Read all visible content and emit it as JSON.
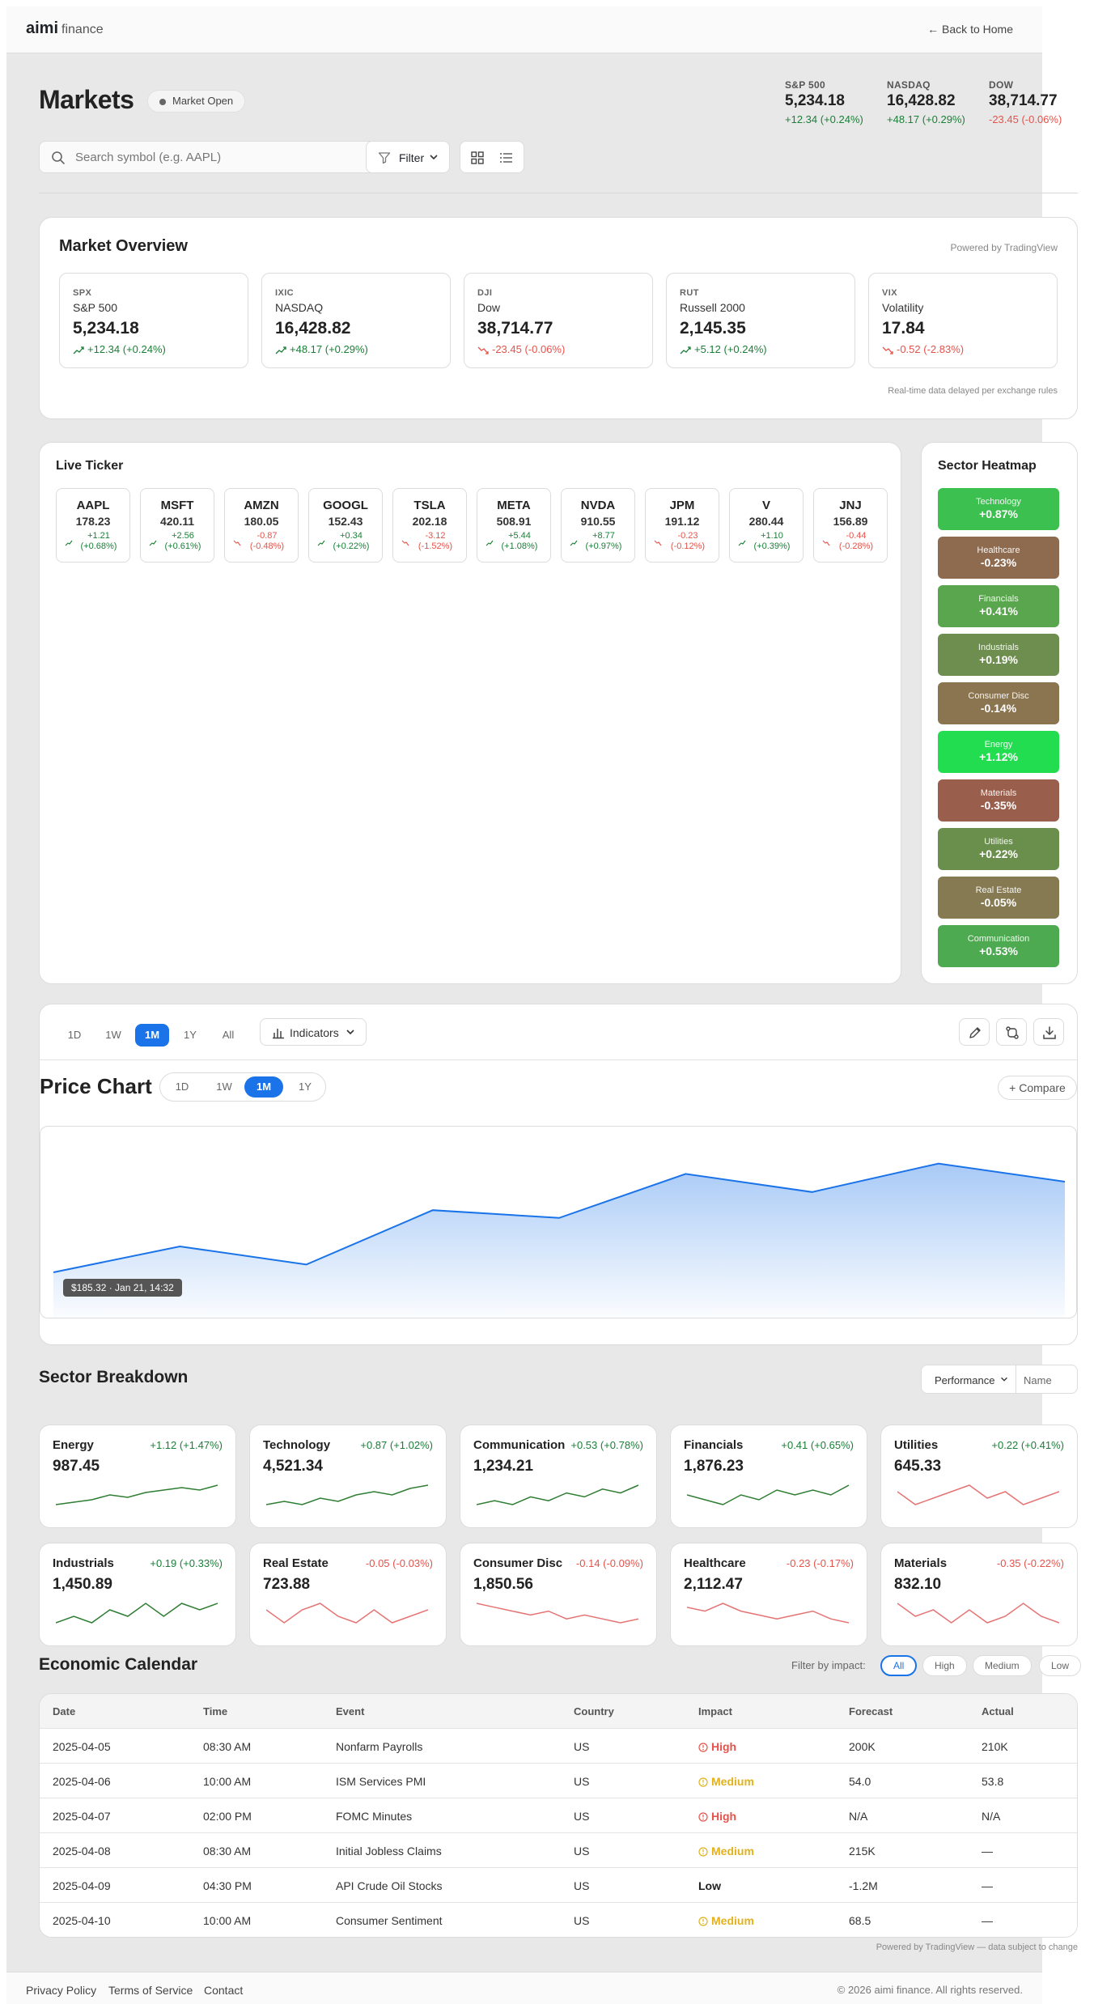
{
  "brand": {
    "name": "aimi",
    "suffix": "finance"
  },
  "nav": {
    "back": "← Back to Home"
  },
  "header": {
    "title": "Markets",
    "status": "Market Open",
    "indices": [
      {
        "name": "S&P 500",
        "value": "5,234.18",
        "change": "+12.34 (+0.24%)",
        "dir": "up"
      },
      {
        "name": "NASDAQ",
        "value": "16,428.82",
        "change": "+48.17 (+0.29%)",
        "dir": "up"
      },
      {
        "name": "DOW",
        "value": "38,714.77",
        "change": "-23.45 (-0.06%)",
        "dir": "down"
      }
    ]
  },
  "toolbar": {
    "search_placeholder": "Search symbol (e.g. AAPL)",
    "filter_label": "Filter"
  },
  "overview": {
    "title": "Market Overview",
    "powered": "Powered by TradingView",
    "footnote": "Real-time data delayed per exchange rules",
    "cards": [
      {
        "symbol": "SPX",
        "name": "S&P 500",
        "price": "5,234.18",
        "change": "+12.34 (+0.24%)",
        "dir": "up"
      },
      {
        "symbol": "IXIC",
        "name": "NASDAQ",
        "price": "16,428.82",
        "change": "+48.17 (+0.29%)",
        "dir": "up"
      },
      {
        "symbol": "DJI",
        "name": "Dow",
        "price": "38,714.77",
        "change": "-23.45 (-0.06%)",
        "dir": "down"
      },
      {
        "symbol": "RUT",
        "name": "Russell 2000",
        "price": "2,145.35",
        "change": "+5.12 (+0.24%)",
        "dir": "up"
      },
      {
        "symbol": "VIX",
        "name": "Volatility",
        "price": "17.84",
        "change": "-0.52 (-2.83%)",
        "dir": "down"
      }
    ]
  },
  "ticker": {
    "title": "Live Ticker",
    "items": [
      {
        "symbol": "AAPL",
        "price": "178.23",
        "change": "+1.21",
        "pct": "(+0.68%)",
        "dir": "up"
      },
      {
        "symbol": "MSFT",
        "price": "420.11",
        "change": "+2.56",
        "pct": "(+0.61%)",
        "dir": "up"
      },
      {
        "symbol": "AMZN",
        "price": "180.05",
        "change": "-0.87",
        "pct": "(-0.48%)",
        "dir": "down"
      },
      {
        "symbol": "GOOGL",
        "price": "152.43",
        "change": "+0.34",
        "pct": "(+0.22%)",
        "dir": "up"
      },
      {
        "symbol": "TSLA",
        "price": "202.18",
        "change": "-3.12",
        "pct": "(-1.52%)",
        "dir": "down"
      },
      {
        "symbol": "META",
        "price": "508.91",
        "change": "+5.44",
        "pct": "(+1.08%)",
        "dir": "up"
      },
      {
        "symbol": "NVDA",
        "price": "910.55",
        "change": "+8.77",
        "pct": "(+0.97%)",
        "dir": "up"
      },
      {
        "symbol": "JPM",
        "price": "191.12",
        "change": "-0.23",
        "pct": "(-0.12%)",
        "dir": "down"
      },
      {
        "symbol": "V",
        "price": "280.44",
        "change": "+1.10",
        "pct": "(+0.39%)",
        "dir": "up"
      },
      {
        "symbol": "JNJ",
        "price": "156.89",
        "change": "-0.44",
        "pct": "(-0.28%)",
        "dir": "down"
      }
    ]
  },
  "heatmap": {
    "title": "Sector Heatmap",
    "cells": [
      {
        "name": "Technology",
        "value": "+0.87%",
        "color": "#3cc04f"
      },
      {
        "name": "Healthcare",
        "value": "-0.23%",
        "color": "#8e6a4e"
      },
      {
        "name": "Financials",
        "value": "+0.41%",
        "color": "#5aa64e"
      },
      {
        "name": "Industrials",
        "value": "+0.19%",
        "color": "#6d8e4e"
      },
      {
        "name": "Consumer Disc",
        "value": "-0.14%",
        "color": "#8a7550"
      },
      {
        "name": "Energy",
        "value": "+1.12%",
        "color": "#22dd4f"
      },
      {
        "name": "Materials",
        "value": "-0.35%",
        "color": "#9a5e4d"
      },
      {
        "name": "Utilities",
        "value": "+0.22%",
        "color": "#6a8f4d"
      },
      {
        "name": "Real Estate",
        "value": "-0.05%",
        "color": "#867a52"
      },
      {
        "name": "Communication",
        "value": "+0.53%",
        "color": "#4eaa50"
      }
    ]
  },
  "chart_panel": {
    "ranges": [
      "1D",
      "1W",
      "1M",
      "1Y",
      "All"
    ],
    "active_range": "1M",
    "indicators_label": "Indicators",
    "title": "Price Chart",
    "chart_ranges": [
      "1D",
      "1W",
      "1M",
      "1Y"
    ],
    "active_chart_range": "1M",
    "compare_label": "+ Compare",
    "tooltip": "$185.32 · Jan 21, 14:32"
  },
  "chart_data": {
    "type": "area",
    "x": [
      0,
      1,
      2,
      3,
      4,
      5,
      6,
      7,
      8
    ],
    "values": [
      162,
      172,
      165,
      186,
      183,
      200,
      193,
      204,
      197
    ],
    "ylim": [
      152,
      212
    ],
    "color": "#1a73e8",
    "grid": false
  },
  "breakdown": {
    "title": "Sector Breakdown",
    "sort_a": "Performance",
    "sort_b": "Name",
    "sectors": [
      {
        "name": "Energy",
        "change": "+1.12 (+1.47%)",
        "value": "987.45",
        "dir": "up",
        "spark": [
          3,
          4,
          5,
          7,
          6,
          8,
          9,
          10,
          9,
          11
        ]
      },
      {
        "name": "Technology",
        "change": "+0.87 (+1.02%)",
        "value": "4,521.34",
        "dir": "up",
        "spark": [
          4,
          5,
          4,
          6,
          5,
          7,
          8,
          7,
          9,
          10
        ]
      },
      {
        "name": "Communication",
        "change": "+0.53 (+0.78%)",
        "value": "1,234.21",
        "dir": "up",
        "spark": [
          5,
          6,
          5,
          7,
          6,
          8,
          7,
          9,
          8,
          10
        ]
      },
      {
        "name": "Financials",
        "change": "+0.41 (+0.65%)",
        "value": "1,876.23",
        "dir": "up",
        "spark": [
          7,
          6,
          5,
          7,
          6,
          8,
          7,
          8,
          7,
          9
        ]
      },
      {
        "name": "Utilities",
        "change": "+0.22 (+0.41%)",
        "value": "645.33",
        "dir": "down",
        "spark": [
          8,
          6,
          7,
          8,
          9,
          7,
          8,
          6,
          7,
          8
        ]
      },
      {
        "name": "Industrials",
        "change": "+0.19 (+0.33%)",
        "value": "1,450.89",
        "dir": "up",
        "spark": [
          5,
          6,
          5,
          7,
          6,
          8,
          6,
          8,
          7,
          8
        ]
      },
      {
        "name": "Real Estate",
        "change": "-0.05 (-0.03%)",
        "value": "723.88",
        "dir": "down",
        "spark": [
          8,
          6,
          8,
          9,
          7,
          6,
          8,
          6,
          7,
          8
        ]
      },
      {
        "name": "Consumer Disc",
        "change": "-0.14 (-0.09%)",
        "value": "1,850.56",
        "dir": "down",
        "spark": [
          10,
          9,
          8,
          7,
          8,
          6,
          7,
          6,
          5,
          6
        ]
      },
      {
        "name": "Healthcare",
        "change": "-0.23 (-0.17%)",
        "value": "2,112.47",
        "dir": "down",
        "spark": [
          9,
          8,
          10,
          8,
          7,
          6,
          7,
          8,
          6,
          5
        ]
      },
      {
        "name": "Materials",
        "change": "-0.35 (-0.22%)",
        "value": "832.10",
        "dir": "down",
        "spark": [
          9,
          7,
          8,
          6,
          8,
          6,
          7,
          9,
          7,
          6
        ]
      }
    ]
  },
  "calendar": {
    "title": "Economic Calendar",
    "filter_label": "Filter by impact:",
    "filters": [
      "All",
      "High",
      "Medium",
      "Low"
    ],
    "active_filter": "All",
    "columns": [
      "Date",
      "Time",
      "Event",
      "Country",
      "Impact",
      "Forecast",
      "Actual"
    ],
    "rows": [
      {
        "date": "2025-04-05",
        "time": "08:30 AM",
        "event": "Nonfarm Payrolls",
        "country": "US",
        "impact": "High",
        "forecast": "200K",
        "actual": "210K"
      },
      {
        "date": "2025-04-06",
        "time": "10:00 AM",
        "event": "ISM Services PMI",
        "country": "US",
        "impact": "Medium",
        "forecast": "54.0",
        "actual": "53.8"
      },
      {
        "date": "2025-04-07",
        "time": "02:00 PM",
        "event": "FOMC Minutes",
        "country": "US",
        "impact": "High",
        "forecast": "N/A",
        "actual": "N/A"
      },
      {
        "date": "2025-04-08",
        "time": "08:30 AM",
        "event": "Initial Jobless Claims",
        "country": "US",
        "impact": "Medium",
        "forecast": "215K",
        "actual": "—"
      },
      {
        "date": "2025-04-09",
        "time": "04:30 PM",
        "event": "API Crude Oil Stocks",
        "country": "US",
        "impact": "Low",
        "forecast": "-1.2M",
        "actual": "—"
      },
      {
        "date": "2025-04-10",
        "time": "10:00 AM",
        "event": "Consumer Sentiment",
        "country": "US",
        "impact": "Medium",
        "forecast": "68.5",
        "actual": "—"
      }
    ],
    "footnote": "Powered by TradingView — data subject to change"
  },
  "footer": {
    "links": [
      "Privacy Policy",
      "Terms of Service",
      "Contact"
    ],
    "copyright": "© 2026 aimi finance. All rights reserved."
  },
  "colors": {
    "accent": "#1a73e8",
    "up": "#1a7f37",
    "down": "#e5534b",
    "medium": "#e2b11b"
  }
}
